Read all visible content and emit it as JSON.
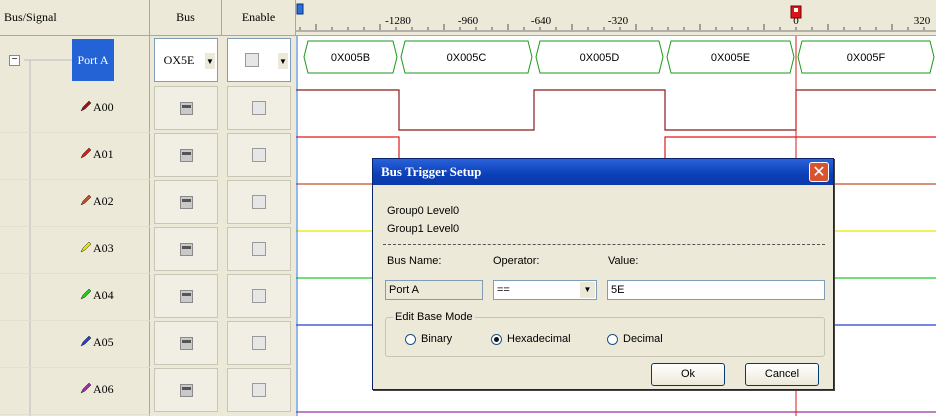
{
  "headers": {
    "bus_signal": "Bus/Signal",
    "bus": "Bus",
    "enable": "Enable"
  },
  "ruler": {
    "ticks": [
      "-1280",
      "-960",
      "-640",
      "-320",
      "0",
      "320"
    ]
  },
  "bus_row": {
    "name": "Port A",
    "bus_value": "OX5E",
    "segments": [
      "0X005B",
      "0X005C",
      "0X005D",
      "0X005E",
      "0X005F"
    ]
  },
  "signals": [
    {
      "name": "A00",
      "color": "#8b1a1a"
    },
    {
      "name": "A01",
      "color": "#e01818"
    },
    {
      "name": "A02",
      "color": "#c0502a"
    },
    {
      "name": "A03",
      "color": "#e6e600"
    },
    {
      "name": "A04",
      "color": "#22cc22"
    },
    {
      "name": "A05",
      "color": "#2040d0"
    },
    {
      "name": "A06",
      "color": "#9a30a0"
    }
  ],
  "dialog": {
    "title": "Bus Trigger Setup",
    "group0": "Group0 Level0",
    "group1": "Group1 Level0",
    "bus_name_label": "Bus Name:",
    "operator_label": "Operator:",
    "value_label": "Value:",
    "bus_name_value": "Port A",
    "operator_value": "==",
    "value_value": "5E",
    "base_mode_label": "Edit Base Mode",
    "radio_binary": "Binary",
    "radio_hex": "Hexadecimal",
    "radio_decimal": "Decimal",
    "selected_base": "Hexadecimal",
    "ok_label": "Ok",
    "cancel_label": "Cancel"
  }
}
